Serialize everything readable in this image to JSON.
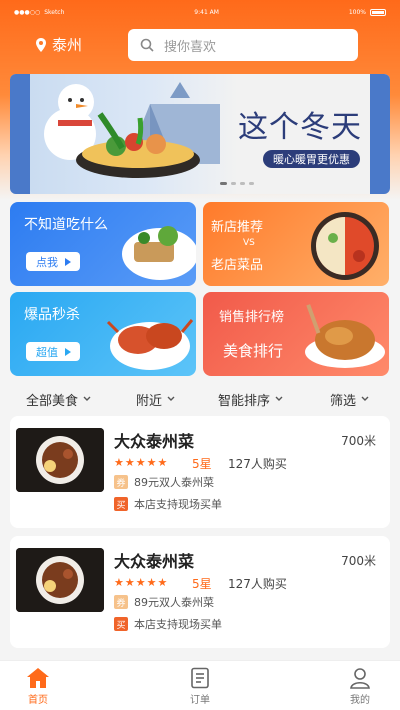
{
  "status_bar": {
    "carrier": "Sketch",
    "time": "9:41 AM",
    "battery": "100%"
  },
  "location": {
    "city": "泰州"
  },
  "search": {
    "placeholder": "搜你喜欢"
  },
  "banner": {
    "title": "这个冬天",
    "subtitle": "暖心暖胃更优惠"
  },
  "tiles": {
    "t1": {
      "label": "不知道吃什么",
      "button": "点我"
    },
    "t2": {
      "line1": "新店推荐",
      "vs": "VS",
      "line2": "老店菜品"
    },
    "t3": {
      "label": "爆品秒杀",
      "button": "超值"
    },
    "t4": {
      "line1": "销售排行榜",
      "line2": "美食排行"
    }
  },
  "filters": [
    {
      "label": "全部美食"
    },
    {
      "label": "附近"
    },
    {
      "label": "智能排序"
    },
    {
      "label": "筛选"
    }
  ],
  "restaurants": [
    {
      "name": "大众泰州菜",
      "distance": "700米",
      "rating_text": "5星",
      "rating_stars": 5,
      "buys": "127人购买",
      "offer_badge": "券",
      "offer": "89元双人泰州菜",
      "pay_badge": "买",
      "pay_note": "本店支持现场买单"
    },
    {
      "name": "大众泰州菜",
      "distance": "700米",
      "rating_text": "5星",
      "rating_stars": 5,
      "buys": "127人购买",
      "offer_badge": "券",
      "offer": "89元双人泰州菜",
      "pay_badge": "买",
      "pay_note": "本店支持现场买单"
    }
  ],
  "tabbar": [
    {
      "label": "首页",
      "icon": "home-icon",
      "active": true
    },
    {
      "label": "订单",
      "icon": "order-icon",
      "active": false
    },
    {
      "label": "我的",
      "icon": "profile-icon",
      "active": false
    }
  ],
  "colors": {
    "accent": "#ff6a1a",
    "banner_text": "#2c3d7a"
  }
}
